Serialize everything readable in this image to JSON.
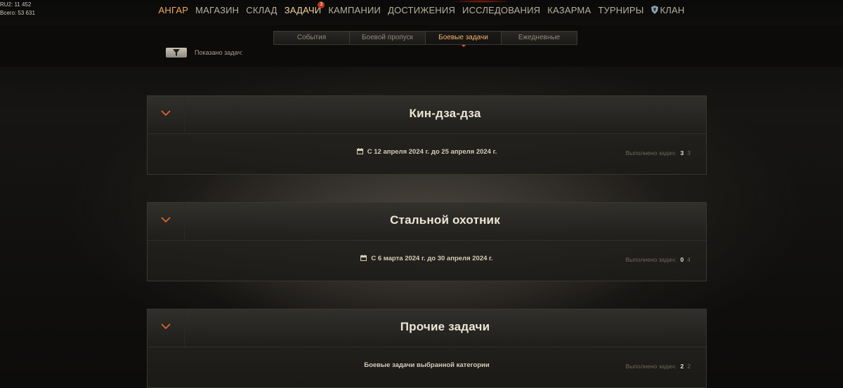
{
  "corner_stats": {
    "line1": "RU2: 11 452",
    "line2": "Всего: 53 631"
  },
  "main_nav": [
    {
      "label": "Ангар",
      "state": "active"
    },
    {
      "label": "Магазин"
    },
    {
      "label": "Склад"
    },
    {
      "label": "Задачи",
      "state": "current",
      "badge": "3"
    },
    {
      "label": "Кампании"
    },
    {
      "label": "Достижения"
    },
    {
      "label": "Исследования"
    },
    {
      "label": "Казарма"
    },
    {
      "label": "Турниры"
    },
    {
      "label": "Клан",
      "icon": "clan-shield-icon"
    }
  ],
  "sub_tabs": [
    {
      "label": "События"
    },
    {
      "label": "Боевой пропуск"
    },
    {
      "label": "Боевые задачи",
      "active": true
    },
    {
      "label": "Ежедневные"
    }
  ],
  "filter": {
    "icon": "filter-funnel-icon",
    "shown_label": "Показано задач:"
  },
  "cards": [
    {
      "title": "Кин-дза-дза",
      "dates": "С 12 апреля 2024 г. до 25 апреля 2024 г.",
      "completed_label": "Выполнено задач:",
      "completed": "3",
      "total": "3"
    },
    {
      "title": "Стальной охотник",
      "dates": "С 6 марта 2024 г. до 30 апреля 2024 г.",
      "completed_label": "Выполнено задач:",
      "completed": "0",
      "total": "4"
    },
    {
      "title": "Прочие задачи",
      "dates": "Боевые задачи выбранной категории",
      "completed_label": "Выполнено задач:",
      "completed": "2",
      "total": "2"
    }
  ],
  "colors": {
    "accent": "#f4a95e",
    "active_tab": "#f6b46a",
    "badge": "#b8361d",
    "chevron": "#e3692b"
  }
}
